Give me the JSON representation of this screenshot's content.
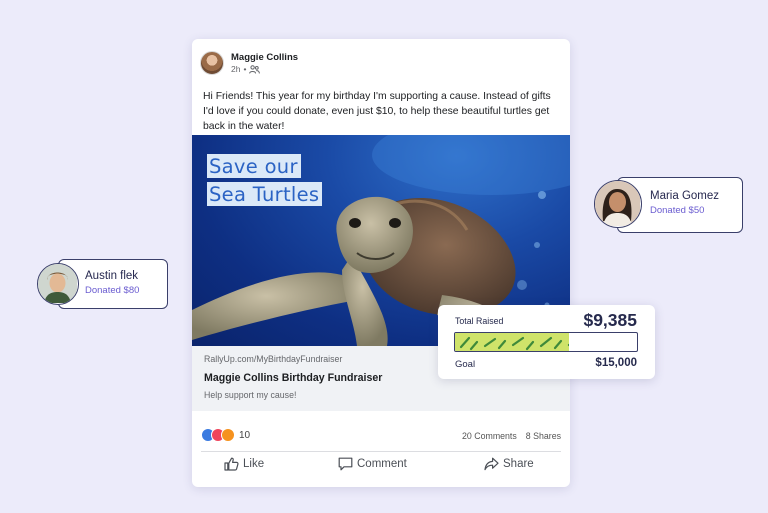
{
  "post": {
    "author": "Maggie Collins",
    "time": "2h",
    "body": "Hi Friends! This year for my birthday I'm supporting a cause. Instead of gifts I'd love if you could donate, even just $10, to help these beautiful turtles get back in the water!",
    "image": {
      "headline_line1": "Save our",
      "headline_line2": "Sea Turtles"
    },
    "link": {
      "url": "RallyUp.com/MyBirthdayFundraiser",
      "title": "Maggie Collins Birthday Fundraiser",
      "description": "Help support my cause!"
    },
    "reaction_count": "10",
    "comments": "20 Comments",
    "shares": "8 Shares",
    "actions": {
      "like": "Like",
      "comment": "Comment",
      "share": "Share"
    }
  },
  "donors": [
    {
      "name": "Maria Gomez",
      "donation": "Donated $50"
    },
    {
      "name": "Austin flek",
      "donation": "Donated $80"
    }
  ],
  "fundraiser": {
    "total_label": "Total Raised",
    "total_amount": "$9,385",
    "goal_label": "Goal",
    "goal_amount": "$15,000",
    "progress_fraction": 0.626
  },
  "colors": {
    "background": "#ecebfa",
    "accent_purple": "#6a5cd0",
    "card_border": "#3a3f6a",
    "progress_fill": "#cfe36a",
    "progress_stripes": "#3f8a3a",
    "reaction_like": "#3b7be0",
    "reaction_love": "#f0455c",
    "reaction_care": "#f6921e"
  },
  "icons": [
    "audience-friends-icon",
    "like-icon",
    "comment-icon",
    "share-icon"
  ]
}
